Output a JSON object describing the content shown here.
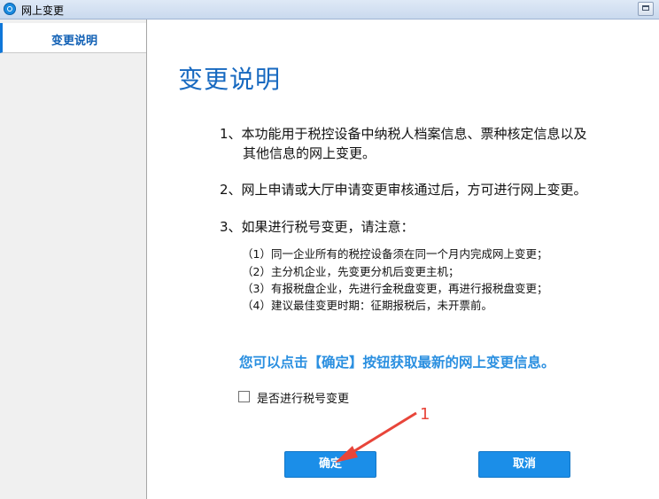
{
  "window": {
    "title": "网上变更"
  },
  "sidebar": {
    "items": [
      {
        "label": "变更说明",
        "active": true
      }
    ]
  },
  "main": {
    "title": "变更说明",
    "items": [
      {
        "line1": "1、本功能用于税控设备中纳税人档案信息、票种核定信息以及",
        "line2": "其他信息的网上变更。"
      },
      {
        "line1": "2、网上申请或大厅申请变更审核通过后，方可进行网上变更。"
      },
      {
        "line1": "3、如果进行税号变更，请注意："
      }
    ],
    "subitems": [
      "（1）同一企业所有的税控设备须在同一个月内完成网上变更；",
      "（2）主分机企业，先变更分机后变更主机；",
      "（3）有报税盘企业，先进行金税盘变更，再进行报税盘变更；",
      "（4）建议最佳变更时期：征期报税后，未开票前。"
    ],
    "hint": "您可以点击【确定】按钮获取最新的网上变更信息。",
    "checkbox": {
      "label": "是否进行税号变更",
      "checked": false
    }
  },
  "buttons": {
    "ok": "确定",
    "cancel": "取消"
  },
  "annotation": {
    "number": "1",
    "color": "#e8453a"
  },
  "colors": {
    "accent": "#1b8ee8",
    "title": "#1769c0",
    "hint": "#2a8fe0"
  }
}
